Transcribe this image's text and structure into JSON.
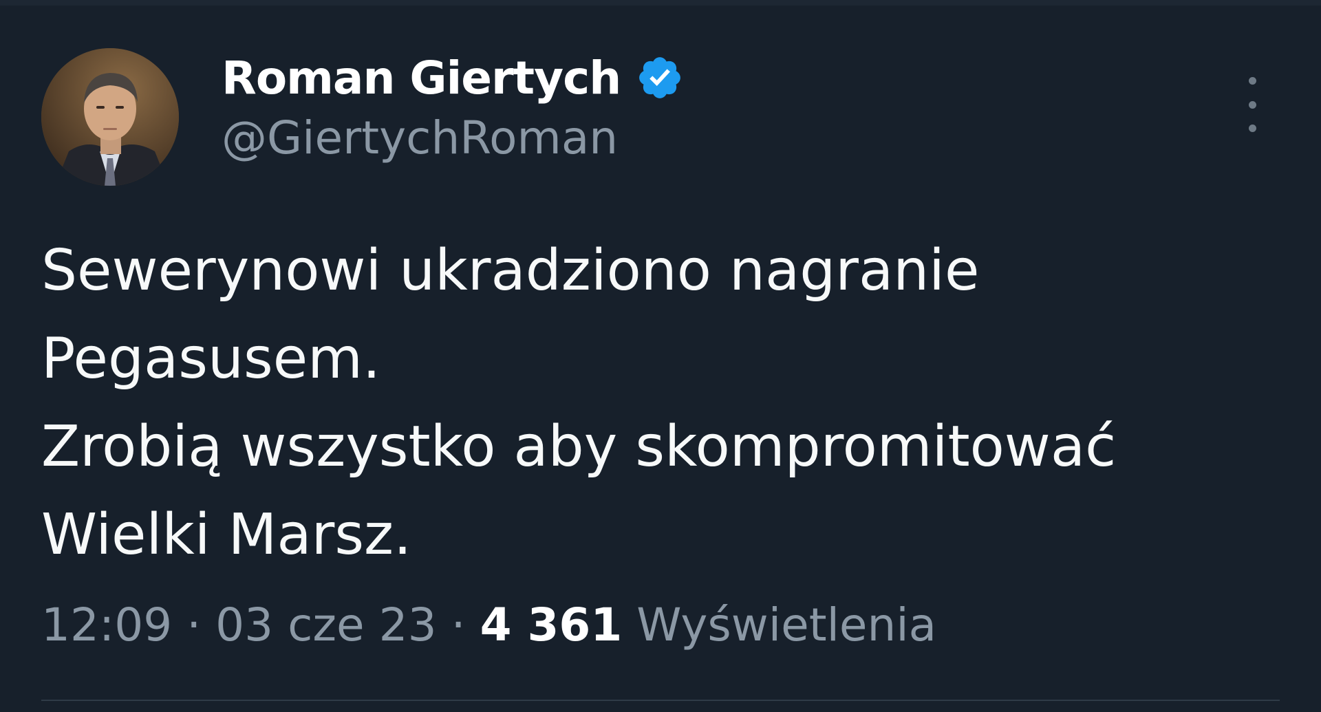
{
  "author": {
    "display_name": "Roman Giertych",
    "handle": "@GiertychRoman",
    "verified": true
  },
  "tweet": {
    "lines": [
      "Sewerynowi ukradziono nagranie",
      "Pegasusem.",
      "Zrobią wszystko aby skompromitować",
      "Wielki Marsz."
    ],
    "time": "12:09",
    "separator": "·",
    "date": "03 cze 23",
    "views_count": "4 361",
    "views_label": "Wyświetlenia"
  },
  "icons": {
    "verified": "verified-badge-icon",
    "more": "more-vertical-icon"
  },
  "colors": {
    "background": "#17202b",
    "verified_blue": "#1d9bf0",
    "secondary_text": "#8b98a5",
    "primary_text": "#ffffff"
  }
}
